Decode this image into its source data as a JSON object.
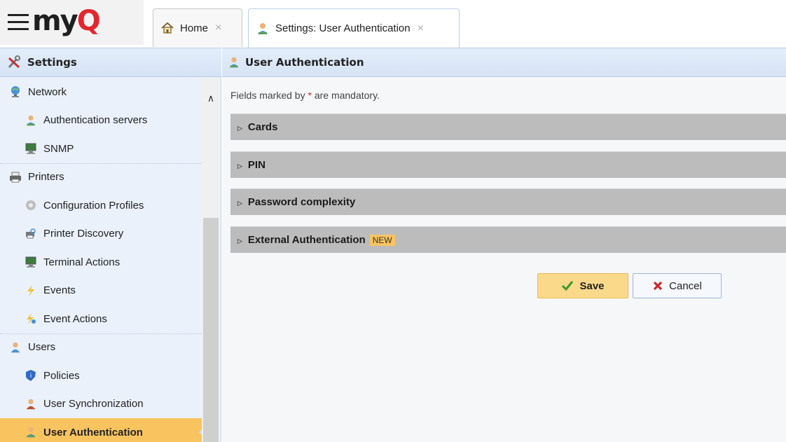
{
  "app": {
    "logo_my": "my",
    "logo_q": "Q"
  },
  "tabs": [
    {
      "label": "Home",
      "icon": "home-icon",
      "close": "×"
    },
    {
      "label": "Settings: User Authentication",
      "icon": "user-key-icon",
      "close": "×"
    }
  ],
  "sidebar": {
    "title": "Settings",
    "items": [
      {
        "label": "Network",
        "icon": "network-globe-icon",
        "kind": "group"
      },
      {
        "label": "Authentication servers",
        "icon": "user-key-icon",
        "kind": "child"
      },
      {
        "label": "SNMP",
        "icon": "monitor-icon",
        "kind": "child"
      },
      {
        "label": "Printers",
        "icon": "printer-icon",
        "kind": "group"
      },
      {
        "label": "Configuration Profiles",
        "icon": "gear-icon",
        "kind": "child"
      },
      {
        "label": "Printer Discovery",
        "icon": "printer-search-icon",
        "kind": "child"
      },
      {
        "label": "Terminal Actions",
        "icon": "monitor-icon",
        "kind": "child"
      },
      {
        "label": "Events",
        "icon": "lightning-icon",
        "kind": "child"
      },
      {
        "label": "Event Actions",
        "icon": "lightning-gear-icon",
        "kind": "child"
      },
      {
        "label": "Users",
        "icon": "user-icon",
        "kind": "group"
      },
      {
        "label": "Policies",
        "icon": "shield-icon",
        "kind": "child"
      },
      {
        "label": "User Synchronization",
        "icon": "user-sync-icon",
        "kind": "child"
      },
      {
        "label": "User Authentication",
        "icon": "user-key-icon",
        "kind": "child",
        "selected": true
      }
    ]
  },
  "main": {
    "title": "User Authentication",
    "mandatory_prefix": "Fields marked by ",
    "mandatory_star": "*",
    "mandatory_suffix": " are mandatory.",
    "sections": [
      {
        "label": "Cards"
      },
      {
        "label": "PIN"
      },
      {
        "label": "Password complexity"
      },
      {
        "label": "External Authentication",
        "badge": "NEW"
      }
    ],
    "save_label": "Save",
    "cancel_label": "Cancel"
  },
  "colors": {
    "accent": "#f9c45f",
    "brand_red": "#e3262e",
    "header_blue": "#d5e3f5"
  }
}
